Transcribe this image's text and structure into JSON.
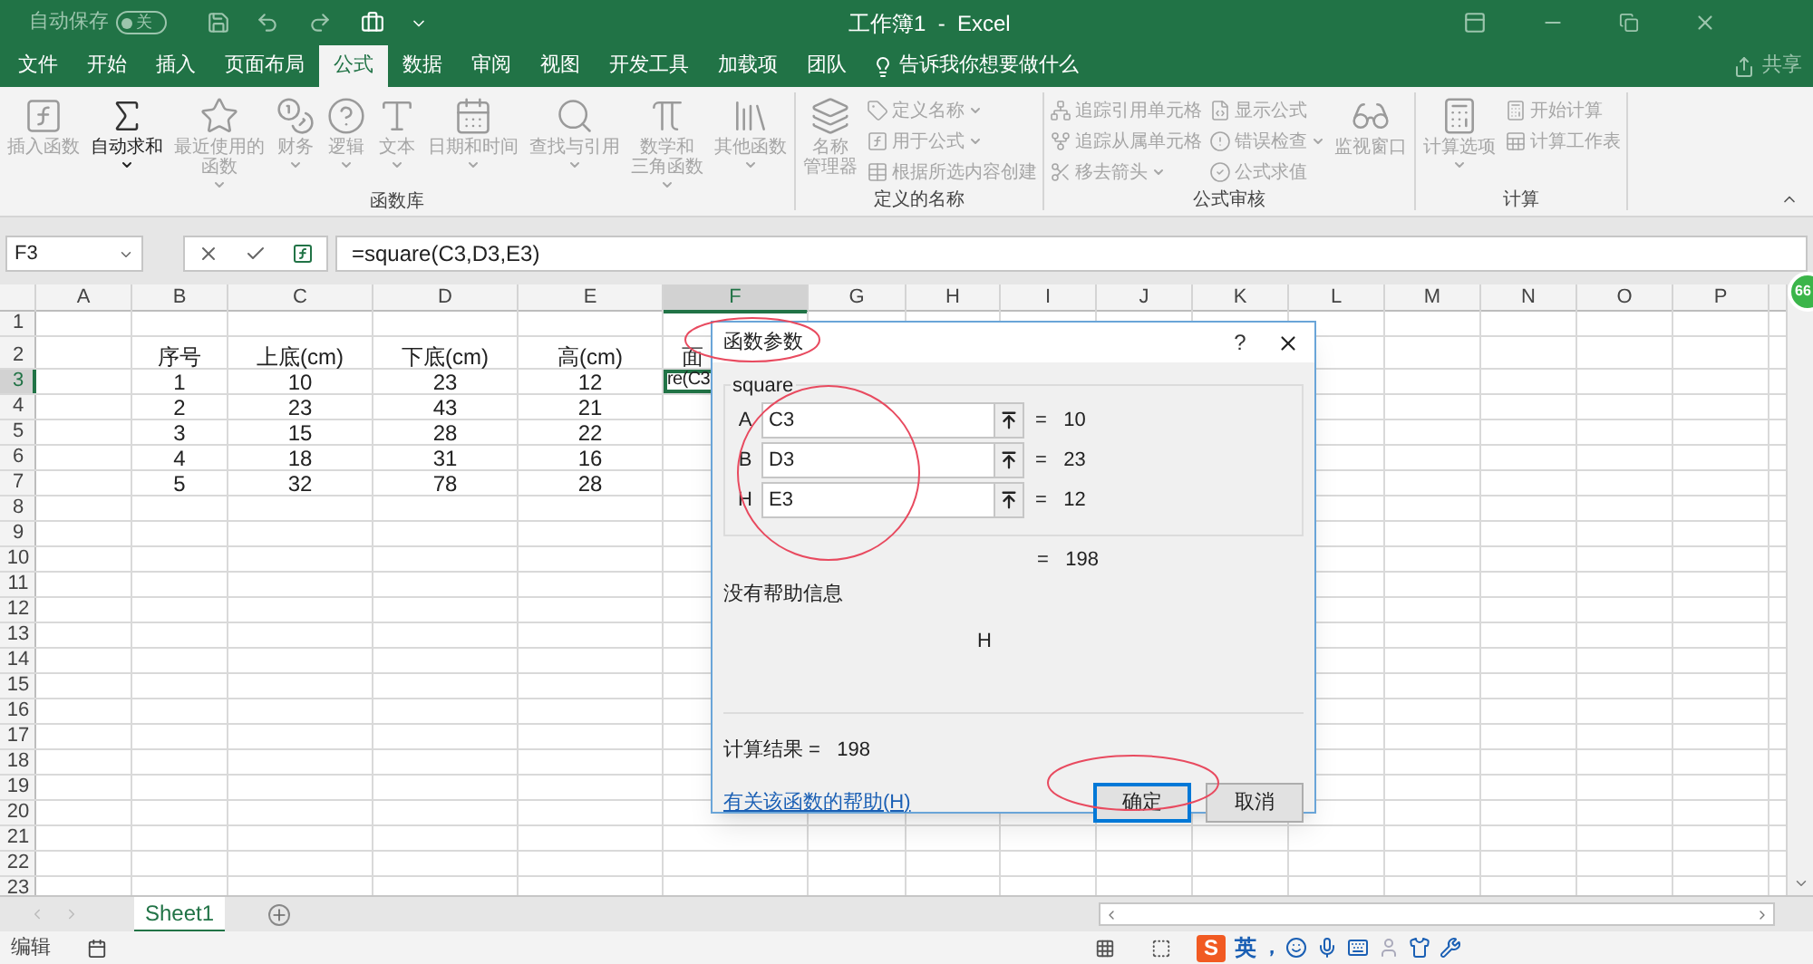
{
  "quick_access": {
    "autosave_label": "自动保存",
    "autosave_toggle": {
      "label": "关",
      "on": false
    }
  },
  "window": {
    "title": "工作簿1  -  Excel"
  },
  "ribbon_tabs": [
    {
      "label": "文件",
      "selected": false
    },
    {
      "label": "开始",
      "selected": false
    },
    {
      "label": "插入",
      "selected": false
    },
    {
      "label": "页面布局",
      "selected": false
    },
    {
      "label": "公式",
      "selected": true
    },
    {
      "label": "数据",
      "selected": false
    },
    {
      "label": "审阅",
      "selected": false
    },
    {
      "label": "视图",
      "selected": false
    },
    {
      "label": "开发工具",
      "selected": false
    },
    {
      "label": "加载项",
      "selected": false
    },
    {
      "label": "团队",
      "selected": false
    }
  ],
  "tell_me": "告诉我你想要做什么",
  "share": "共享",
  "ribbon_groups": [
    {
      "title": "函数库",
      "items": [
        {
          "kind": "large",
          "lines": [
            "插入函数"
          ],
          "dropdown": false,
          "disabled": true
        },
        {
          "kind": "large",
          "lines": [
            "自动求和"
          ],
          "dropdown": true,
          "disabled": false
        },
        {
          "kind": "large",
          "lines": [
            "最近使用的",
            "函数"
          ],
          "dropdown": true,
          "disabled": true
        },
        {
          "kind": "large",
          "lines": [
            "财务"
          ],
          "dropdown": true,
          "disabled": true
        },
        {
          "kind": "large",
          "lines": [
            "逻辑"
          ],
          "dropdown": true,
          "disabled": true
        },
        {
          "kind": "large",
          "lines": [
            "文本"
          ],
          "dropdown": true,
          "disabled": true
        },
        {
          "kind": "large",
          "lines": [
            "日期和时间"
          ],
          "dropdown": true,
          "disabled": true
        },
        {
          "kind": "large",
          "lines": [
            "查找与引用"
          ],
          "dropdown": true,
          "disabled": true
        },
        {
          "kind": "large",
          "lines": [
            "数学和",
            "三角函数"
          ],
          "dropdown": true,
          "disabled": true
        },
        {
          "kind": "large",
          "lines": [
            "其他函数"
          ],
          "dropdown": true,
          "disabled": true
        }
      ]
    },
    {
      "title": "定义的名称",
      "items": [
        {
          "kind": "large",
          "lines": [
            "名称",
            "管理器"
          ],
          "dropdown": false,
          "disabled": true
        },
        {
          "kind": "stack",
          "items": [
            {
              "label": "定义名称",
              "dropdown": true,
              "disabled": true
            },
            {
              "label": "用于公式",
              "dropdown": true,
              "disabled": true
            },
            {
              "label": "根据所选内容创建",
              "dropdown": false,
              "disabled": true
            }
          ]
        }
      ]
    },
    {
      "title": "公式审核",
      "items": [
        {
          "kind": "stack",
          "items": [
            {
              "label": "追踪引用单元格",
              "dropdown": false,
              "disabled": true
            },
            {
              "label": "追踪从属单元格",
              "dropdown": false,
              "disabled": true
            },
            {
              "label": "移去箭头",
              "dropdown": true,
              "disabled": true
            }
          ]
        },
        {
          "kind": "stack",
          "items": [
            {
              "label": "显示公式",
              "dropdown": false,
              "disabled": true
            },
            {
              "label": "错误检查",
              "dropdown": true,
              "disabled": true
            },
            {
              "label": "公式求值",
              "dropdown": false,
              "disabled": true
            }
          ]
        },
        {
          "kind": "large",
          "lines": [
            "监视窗口"
          ],
          "dropdown": false,
          "disabled": true
        }
      ]
    },
    {
      "title": "计算",
      "items": [
        {
          "kind": "large",
          "lines": [
            "计算选项"
          ],
          "dropdown": true,
          "disabled": true
        },
        {
          "kind": "stack",
          "items": [
            {
              "label": "开始计算",
              "dropdown": false,
              "disabled": true
            },
            {
              "label": "计算工作表",
              "dropdown": false,
              "disabled": true
            }
          ]
        }
      ]
    }
  ],
  "formula_bar": {
    "name_box": "F3",
    "formula": "=square(C3,D3,E3)"
  },
  "sheet": {
    "columns": [
      {
        "label": "A",
        "selected": false
      },
      {
        "label": "B",
        "selected": false
      },
      {
        "label": "C",
        "selected": false
      },
      {
        "label": "D",
        "selected": false
      },
      {
        "label": "E",
        "selected": false
      },
      {
        "label": "F",
        "selected": true
      },
      {
        "label": "G",
        "selected": false
      },
      {
        "label": "H",
        "selected": false
      },
      {
        "label": "I",
        "selected": false
      },
      {
        "label": "J",
        "selected": false
      },
      {
        "label": "K",
        "selected": false
      },
      {
        "label": "L",
        "selected": false
      },
      {
        "label": "M",
        "selected": false
      },
      {
        "label": "N",
        "selected": false
      },
      {
        "label": "O",
        "selected": false
      },
      {
        "label": "P",
        "selected": false
      }
    ],
    "rows": [
      {
        "number": "1",
        "selected": false
      },
      {
        "number": "2",
        "selected": false,
        "cells": {
          "B": {
            "text": "序号",
            "selected": false
          },
          "C": {
            "text": "上底(cm)",
            "selected": false
          },
          "D": {
            "text": "下底(cm)",
            "selected": false
          },
          "E": {
            "text": "高(cm)",
            "selected": false
          },
          "F": {
            "text": "面",
            "selected": false
          }
        }
      },
      {
        "number": "3",
        "selected": true,
        "cells": {
          "B": {
            "text": "1",
            "selected": false
          },
          "C": {
            "text": "10",
            "selected": false
          },
          "D": {
            "text": "23",
            "selected": false
          },
          "E": {
            "text": "12",
            "selected": false
          },
          "F": {
            "text": "re(C3",
            "selected": true
          }
        }
      },
      {
        "number": "4",
        "selected": false,
        "cells": {
          "B": {
            "text": "2",
            "selected": false
          },
          "C": {
            "text": "23",
            "selected": false
          },
          "D": {
            "text": "43",
            "selected": false
          },
          "E": {
            "text": "21",
            "selected": false
          }
        }
      },
      {
        "number": "5",
        "selected": false,
        "cells": {
          "B": {
            "text": "3",
            "selected": false
          },
          "C": {
            "text": "15",
            "selected": false
          },
          "D": {
            "text": "28",
            "selected": false
          },
          "E": {
            "text": "22",
            "selected": false
          }
        }
      },
      {
        "number": "6",
        "selected": false,
        "cells": {
          "B": {
            "text": "4",
            "selected": false
          },
          "C": {
            "text": "18",
            "selected": false
          },
          "D": {
            "text": "31",
            "selected": false
          },
          "E": {
            "text": "16",
            "selected": false
          }
        }
      },
      {
        "number": "7",
        "selected": false,
        "cells": {
          "B": {
            "text": "5",
            "selected": false
          },
          "C": {
            "text": "32",
            "selected": false
          },
          "D": {
            "text": "78",
            "selected": false
          },
          "E": {
            "text": "28",
            "selected": false
          }
        }
      },
      {
        "number": "8",
        "selected": false
      },
      {
        "number": "9",
        "selected": false
      },
      {
        "number": "10",
        "selected": false
      },
      {
        "number": "11",
        "selected": false
      },
      {
        "number": "12",
        "selected": false
      },
      {
        "number": "13",
        "selected": false
      },
      {
        "number": "14",
        "selected": false
      },
      {
        "number": "15",
        "selected": false
      },
      {
        "number": "16",
        "selected": false
      },
      {
        "number": "17",
        "selected": false
      },
      {
        "number": "18",
        "selected": false
      },
      {
        "number": "19",
        "selected": false
      },
      {
        "number": "20",
        "selected": false
      },
      {
        "number": "21",
        "selected": false
      },
      {
        "number": "22",
        "selected": false
      },
      {
        "number": "23",
        "selected": false
      }
    ]
  },
  "badge": "66",
  "dialog": {
    "title": "函数参数",
    "help": "?",
    "function_name": "square",
    "arguments": [
      {
        "label": "A",
        "value": "C3",
        "result": "=   10"
      },
      {
        "label": "B",
        "value": "D3",
        "result": "=   23"
      },
      {
        "label": "H",
        "value": "E3",
        "result": "=   12"
      }
    ],
    "total": "=   198",
    "description": "没有帮助信息",
    "argument_help": "H",
    "result_label": "计算结果 =   198",
    "help_link": "有关该函数的帮助(H)",
    "buttons": [
      {
        "label": "确定",
        "default": true
      },
      {
        "label": "取消",
        "default": false
      }
    ]
  },
  "sheet_tabs": [
    {
      "label": "Sheet1",
      "selected": true
    }
  ],
  "status_bar": {
    "mode": "编辑",
    "ime": {
      "logo": "S",
      "language": "英",
      "punctuation": "，"
    }
  }
}
